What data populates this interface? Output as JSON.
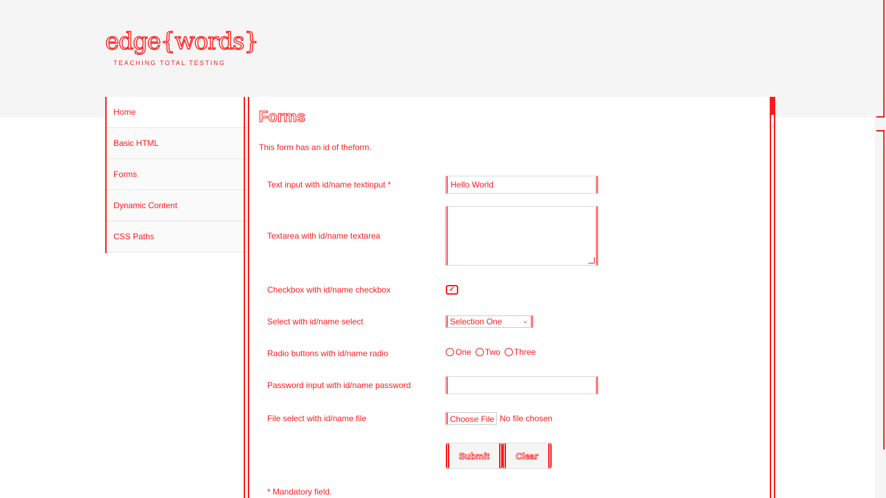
{
  "logo": {
    "word_a": "edge",
    "word_b": "words",
    "tagline": "TEACHING TOTAL TESTING"
  },
  "sidebar": {
    "items": [
      {
        "label": "Home"
      },
      {
        "label": "Basic HTML"
      },
      {
        "label": "Forms"
      },
      {
        "label": "Dynamic Content"
      },
      {
        "label": "CSS Paths"
      }
    ]
  },
  "main": {
    "title": "Forms",
    "intro": "This form has an id of theform."
  },
  "form": {
    "text_label": "Text input with id/name textinput *",
    "text_value": "Hello World",
    "textarea_label": "Textarea with id/name textarea",
    "checkbox_label": "Checkbox with id/name checkbox",
    "checkbox_checked": "✓",
    "select_label": "Select with id/name select",
    "select_value": "Selection One",
    "radio_label": "Radio buttons with id/name radio",
    "radio_options": [
      "One",
      "Two",
      "Three"
    ],
    "password_label": "Password input with id/name password",
    "file_label": "File select with id/name file",
    "file_button": "Choose File",
    "file_status": "No file chosen",
    "submit_label": "Submit",
    "clear_label": "Clear",
    "footnote": "* Mandatory field."
  },
  "colors": {
    "accent": "#ff1a1a",
    "header_bg": "#f5f5f5"
  }
}
